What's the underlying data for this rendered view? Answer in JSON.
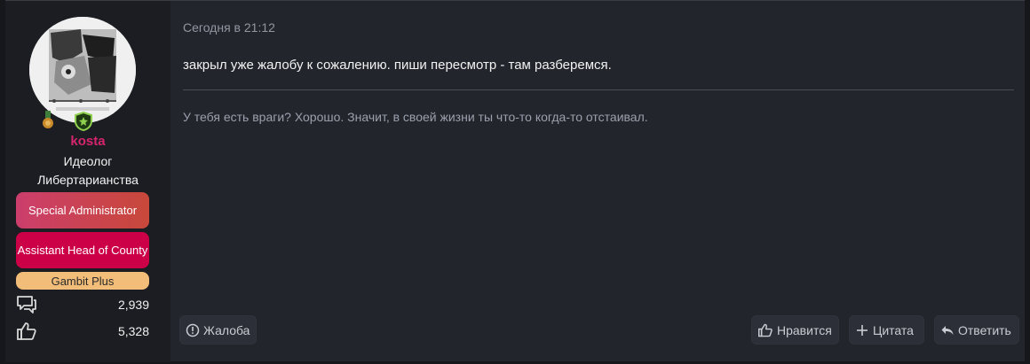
{
  "user": {
    "name": "kosta",
    "title": "Идеолог Либертарианства",
    "banners": [
      {
        "label": "Special Administrator"
      },
      {
        "label": "Assistant Head of County"
      },
      {
        "label": "Gambit Plus"
      }
    ],
    "stats": {
      "messages": "2,939",
      "reactions": "5,328"
    }
  },
  "post": {
    "date": "Сегодня в 21:12",
    "message": "закрыл уже жалобу к сожалению. пиши пересмотр - там разберемся.",
    "signature": "У тебя есть враги? Хорошо. Значит, в своей жизни ты что-то когда-то отстаивал."
  },
  "actions": {
    "report": "Жалоба",
    "like": "Нравится",
    "quote": "Цитата",
    "reply": "Ответить"
  },
  "colors": {
    "username": "#d6246e",
    "banner_special_admin": "#c8483a",
    "banner_assistant_head": "#cc0047",
    "banner_gambit_plus": "#f2bd78"
  }
}
